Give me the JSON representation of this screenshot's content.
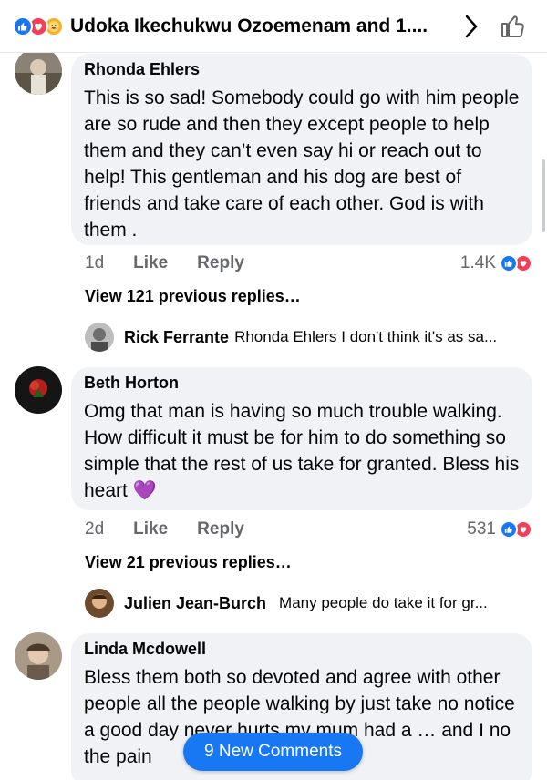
{
  "header": {
    "title": "Udoka Ikechukwu Ozoemenam and 1....",
    "icons": [
      "like-reaction-icon",
      "love-reaction-icon",
      "care-reaction-icon",
      "chevron-right-icon",
      "thumbs-up-icon"
    ]
  },
  "comments": [
    {
      "author": "Rhonda Ehlers",
      "text": "This is so sad! Somebody could go with him people are so rude and then they except people to help them and they can’t even say hi or reach out to help! This gentleman and his dog are best of friends and take care of each other. God is with them .",
      "time": "1d",
      "like": "Like",
      "reply": "Reply",
      "reaction_count": "1.4K",
      "view_replies": "View 121 previous replies…",
      "latest_reply": {
        "author": "Rick Ferrante",
        "text": "Rhonda Ehlers I don't think it's as sa..."
      }
    },
    {
      "author": "Beth Horton",
      "text": "Omg that man is having so much trouble walking. How difficult it must be for him to do something so simple that the rest of us take for granted. Bless his heart 💜",
      "time": "2d",
      "like": "Like",
      "reply": "Reply",
      "reaction_count": "531",
      "view_replies": "View 21 previous replies…",
      "latest_reply": {
        "author": "Julien Jean-Burch",
        "text": "Many people do take it for gr..."
      }
    },
    {
      "author": "Linda Mcdowell",
      "text": "Bless them both so devoted and agree with other people all the people walking by just take no notice a good day never hurts my mum had a … and I no the pain"
    }
  ],
  "new_comments_label": "9 New Comments",
  "colors": {
    "accent": "#1877f2",
    "love": "#f33e58",
    "bubble": "#f0f2f5",
    "muted": "#65676b"
  }
}
